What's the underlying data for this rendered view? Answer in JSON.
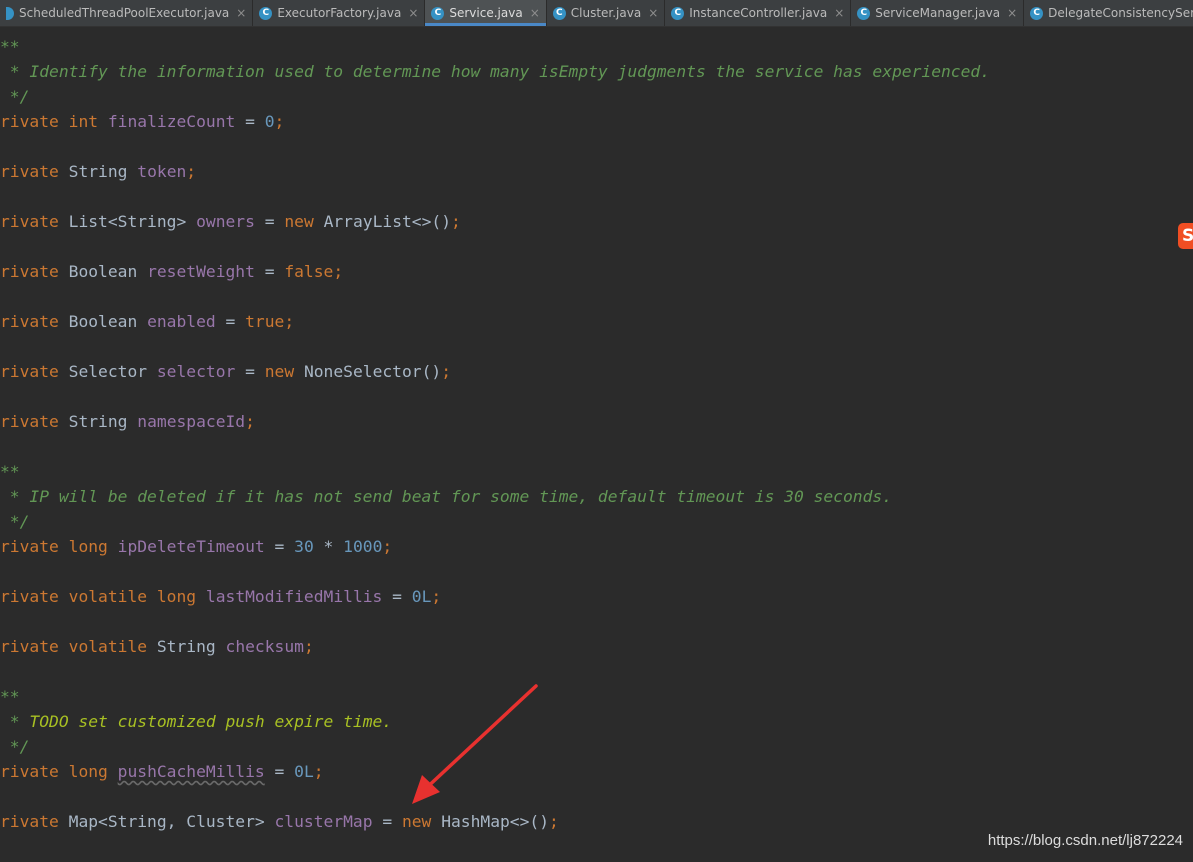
{
  "tabs": [
    {
      "label": "ScheduledThreadPoolExecutor.java",
      "active": false,
      "icon": "class-icon"
    },
    {
      "label": "ExecutorFactory.java",
      "active": false,
      "icon": "class-icon"
    },
    {
      "label": "Service.java",
      "active": true,
      "icon": "class-icon"
    },
    {
      "label": "Cluster.java",
      "active": false,
      "icon": "class-icon"
    },
    {
      "label": "InstanceController.java",
      "active": false,
      "icon": "class-icon"
    },
    {
      "label": "ServiceManager.java",
      "active": false,
      "icon": "class-icon"
    },
    {
      "label": "DelegateConsistencyServiceIn",
      "active": false,
      "icon": "class-icon"
    }
  ],
  "close_glyph": "×",
  "code": {
    "c1_open": "**",
    "c1_text": " * Identify the information used to determine how many isEmpty judgments the service has experienced.",
    "c1_close": " */",
    "l_finalize": {
      "mod": "rivate",
      "type": "int",
      "name": "finalizeCount",
      "eq": " = ",
      "val": "0",
      "end": ";"
    },
    "l_token": {
      "mod": "rivate",
      "type": "String",
      "name": "token",
      "end": ";"
    },
    "l_owners": {
      "mod": "rivate",
      "type": "List<String>",
      "name": "owners",
      "eq": " = ",
      "kw": "new",
      "rest": "ArrayList<>()",
      "end": ";"
    },
    "l_reset": {
      "mod": "rivate",
      "type": "Boolean",
      "name": "resetWeight",
      "eq": " = ",
      "val": "false",
      "end": ";"
    },
    "l_enabled": {
      "mod": "rivate",
      "type": "Boolean",
      "name": "enabled",
      "eq": " = ",
      "val": "true",
      "end": ";"
    },
    "l_selector": {
      "mod": "rivate",
      "type": "Selector",
      "name": "selector",
      "eq": " = ",
      "kw": "new",
      "rest": "NoneSelector()",
      "end": ";"
    },
    "l_namespace": {
      "mod": "rivate",
      "type": "String",
      "name": "namespaceId",
      "end": ";"
    },
    "c2_open": "**",
    "c2_text": " * IP will be deleted if it has not send beat for some time, default timeout is 30 seconds.",
    "c2_close": " */",
    "l_ipdel": {
      "mod": "rivate",
      "type": "long",
      "name": "ipDeleteTimeout",
      "eq": " = ",
      "val": "30",
      "op": " * ",
      "val2": "1000",
      "end": ";"
    },
    "l_lastmod": {
      "mod": "rivate",
      "vol": "volatile",
      "type": "long",
      "name": "lastModifiedMillis",
      "eq": " = ",
      "val": "0L",
      "end": ";"
    },
    "l_checksum": {
      "mod": "rivate",
      "vol": "volatile",
      "type": "String",
      "name": "checksum",
      "end": ";"
    },
    "c3_open": "**",
    "c3_text": "TODO set customized push expire time.",
    "c3_prefix": " * ",
    "c3_close": " */",
    "l_push": {
      "mod": "rivate",
      "type": "long",
      "name": "pushCacheMillis",
      "eq": " = ",
      "val": "0L",
      "end": ";"
    },
    "l_cluster": {
      "mod": "rivate",
      "type": "Map<String, Cluster>",
      "name": "clusterMap",
      "eq": " = ",
      "kw": "new",
      "rest": "HashMap<>()",
      "end": ";"
    }
  },
  "watermark": "https://blog.csdn.net/lj872224",
  "logo_letter": "S",
  "colors": {
    "arrow": "#e8312f",
    "keyword": "#cc7832",
    "field": "#9876aa",
    "number": "#6897bb",
    "comment": "#629755"
  }
}
